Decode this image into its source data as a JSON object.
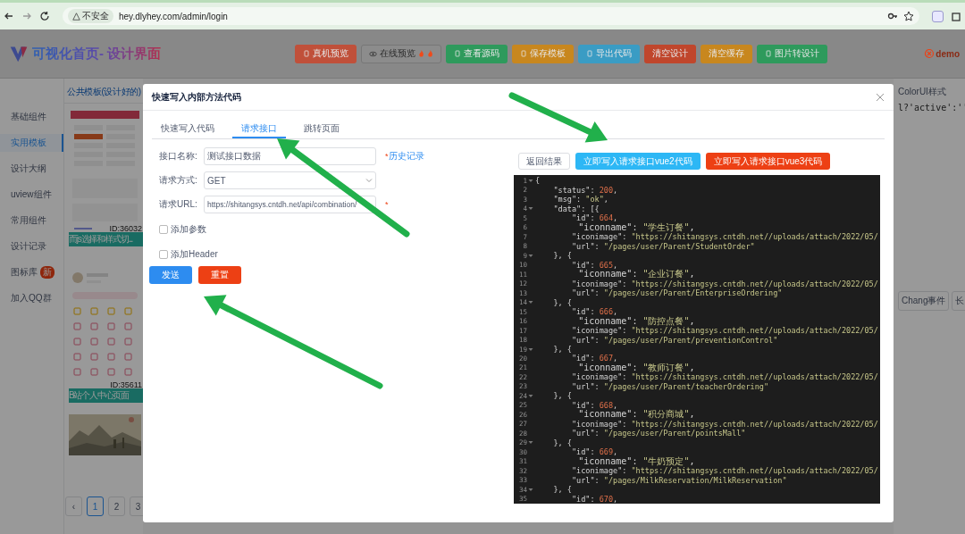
{
  "browser": {
    "security_label": "不安全",
    "url": "hey.dlyhey.com/admin/login"
  },
  "header": {
    "logo": "可视化首页- 设计界面",
    "buttons": [
      {
        "label": "真机预览",
        "kind": "icon",
        "color": "#c0503a"
      },
      {
        "label": "在线预览",
        "kind": "flame"
      },
      {
        "label": "查看源码",
        "kind": "icon",
        "color": "#2e9a5c"
      },
      {
        "label": "保存模板",
        "kind": "icon",
        "color": "#c8871e"
      },
      {
        "label": "导出代码",
        "kind": "icon",
        "color": "#3a9cc4"
      },
      {
        "label": "清空设计",
        "kind": "plain",
        "color": "#c0462c"
      },
      {
        "label": "清空缓存",
        "kind": "plain",
        "color": "#c8871e"
      },
      {
        "label": "图片转设计",
        "kind": "icon",
        "color": "#2e9a5c"
      }
    ],
    "user": "demo"
  },
  "sidebar": {
    "items": [
      {
        "label": "基础组件",
        "selected": false
      },
      {
        "label": "实用模板",
        "selected": true
      },
      {
        "label": "设计大纲",
        "selected": false
      },
      {
        "label": "uview组件",
        "selected": false
      },
      {
        "label": "常用组件",
        "selected": false
      },
      {
        "label": "设计记录",
        "selected": false
      },
      {
        "label": "图标库",
        "selected": false,
        "badge": "新"
      },
      {
        "label": "加入QQ群",
        "selected": false
      }
    ]
  },
  "templates": {
    "title": "公共模板(设计好的)",
    "cards": [
      {
        "kind": "form",
        "id_label": "ID:36032",
        "caption": "而js选择和样式切..."
      },
      {
        "kind": "profile",
        "id_label": "ID:35611",
        "caption": "B站个人中心页面"
      },
      {
        "kind": "picture"
      }
    ],
    "pagination": [
      {
        "label": "‹",
        "selected": false
      },
      {
        "label": "1",
        "selected": true
      },
      {
        "label": "2",
        "selected": false
      },
      {
        "label": "3",
        "selected": false
      }
    ]
  },
  "right_panel": {
    "tab": "ColorUI样式",
    "code": "l?'active':''",
    "buttons": [
      "Chang事件",
      "长"
    ]
  },
  "modal": {
    "title": "快速写入内部方法代码",
    "tabs": [
      {
        "label": "快速写入代码",
        "selected": false
      },
      {
        "label": "请求接口",
        "selected": true
      },
      {
        "label": "跳转页面",
        "selected": false
      }
    ],
    "fields": [
      {
        "label": "接口名称:",
        "kind": "text",
        "value": "测试接口数据",
        "mark": "*",
        "link": "历史记录"
      },
      {
        "label": "请求方式:",
        "kind": "select",
        "value": "GET"
      },
      {
        "label": "请求URL:",
        "kind": "text",
        "value": "https://shitangsys.cntdh.net/api/combination/",
        "mark": "*"
      }
    ],
    "checkboxes": [
      {
        "label": "添加参数",
        "checked": false
      },
      {
        "label": "添加Header",
        "checked": false
      }
    ],
    "buttons": [
      {
        "label": "发送",
        "color": "#2d8cf0"
      },
      {
        "label": "重置",
        "color": "#ed4014"
      }
    ],
    "result_buttons": [
      {
        "label": "返回结果",
        "kind": "plain"
      },
      {
        "label": "立即写入请求接口vue2代码",
        "kind": "filled",
        "color": "#2db7f5"
      },
      {
        "label": "立即写入请求接口vue3代码",
        "kind": "filled",
        "color": "#ed4014"
      }
    ],
    "code_lines": [
      {
        "n": "1",
        "text": "{",
        "fold": true
      },
      {
        "n": "2",
        "text": "    \"status\": 200,",
        "fold": false
      },
      {
        "n": "3",
        "text": "    \"msg\": \"ok\",",
        "fold": false
      },
      {
        "n": "4",
        "text": "    \"data\": [{",
        "fold": true
      },
      {
        "n": "5",
        "text": "        \"id\": 664,",
        "fold": false
      },
      {
        "n": "6",
        "text": "        \"iconname\": \"学生订餐\",",
        "fold": false
      },
      {
        "n": "7",
        "text": "        \"iconimage\": \"https://shitangsys.cntdh.net//uploads/attach/2022/05/",
        "fold": false
      },
      {
        "n": "8",
        "text": "        \"url\": \"/pages/user/Parent/StudentOrder\"",
        "fold": false
      },
      {
        "n": "9",
        "text": "    }, {",
        "fold": true
      },
      {
        "n": "10",
        "text": "        \"id\": 665,",
        "fold": false
      },
      {
        "n": "11",
        "text": "        \"iconname\": \"企业订餐\",",
        "fold": false
      },
      {
        "n": "12",
        "text": "        \"iconimage\": \"https://shitangsys.cntdh.net//uploads/attach/2022/05/",
        "fold": false
      },
      {
        "n": "13",
        "text": "        \"url\": \"/pages/user/Parent/EnterpriseOrdering\"",
        "fold": false
      },
      {
        "n": "14",
        "text": "    }, {",
        "fold": true
      },
      {
        "n": "15",
        "text": "        \"id\": 666,",
        "fold": false
      },
      {
        "n": "16",
        "text": "        \"iconname\": \"防控点餐\",",
        "fold": false
      },
      {
        "n": "17",
        "text": "        \"iconimage\": \"https://shitangsys.cntdh.net//uploads/attach/2022/05/",
        "fold": false
      },
      {
        "n": "18",
        "text": "        \"url\": \"/pages/user/Parent/preventionControl\"",
        "fold": false
      },
      {
        "n": "19",
        "text": "    }, {",
        "fold": true
      },
      {
        "n": "20",
        "text": "        \"id\": 667,",
        "fold": false
      },
      {
        "n": "21",
        "text": "        \"iconname\": \"教师订餐\",",
        "fold": false
      },
      {
        "n": "22",
        "text": "        \"iconimage\": \"https://shitangsys.cntdh.net//uploads/attach/2022/05/",
        "fold": false
      },
      {
        "n": "23",
        "text": "        \"url\": \"/pages/user/Parent/teacherOrdering\"",
        "fold": false
      },
      {
        "n": "24",
        "text": "    }, {",
        "fold": true
      },
      {
        "n": "25",
        "text": "        \"id\": 668,",
        "fold": false
      },
      {
        "n": "26",
        "text": "        \"iconname\": \"积分商城\",",
        "fold": false
      },
      {
        "n": "27",
        "text": "        \"iconimage\": \"https://shitangsys.cntdh.net//uploads/attach/2022/05/",
        "fold": false
      },
      {
        "n": "28",
        "text": "        \"url\": \"/pages/user/Parent/pointsMall\"",
        "fold": false
      },
      {
        "n": "29",
        "text": "    }, {",
        "fold": true
      },
      {
        "n": "30",
        "text": "        \"id\": 669,",
        "fold": false
      },
      {
        "n": "31",
        "text": "        \"iconname\": \"牛奶预定\",",
        "fold": false
      },
      {
        "n": "32",
        "text": "        \"iconimage\": \"https://shitangsys.cntdh.net//uploads/attach/2022/05/",
        "fold": false
      },
      {
        "n": "33",
        "text": "        \"url\": \"/pages/MilkReservation/MilkReservation\"",
        "fold": false
      },
      {
        "n": "34",
        "text": "    }, {",
        "fold": true
      },
      {
        "n": "35",
        "text": "        \"id\": 670,",
        "fold": false
      }
    ]
  }
}
